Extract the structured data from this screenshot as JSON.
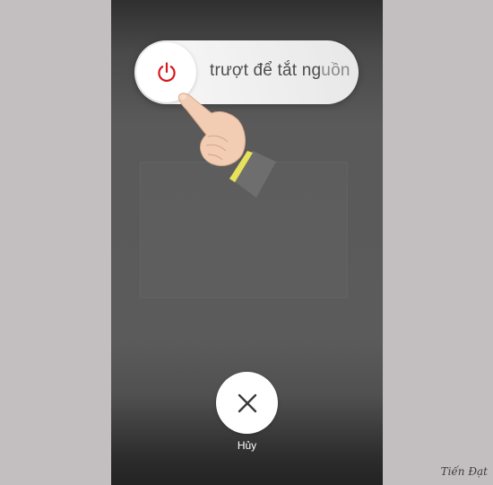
{
  "power_slider": {
    "label_main": "trượt để tắt ng",
    "label_fade": "uồn"
  },
  "cancel": {
    "label": "Hủy"
  },
  "watermark": {
    "text": "Tiến Đạt"
  },
  "icons": {
    "power": "power-icon",
    "close": "close-icon",
    "hand": "pointing-hand"
  },
  "colors": {
    "power_icon": "#d8171c",
    "screen_bg": "#5a5a5a",
    "page_bg": "#c3bfc0",
    "cuff_stripe": "#e7e25a"
  }
}
